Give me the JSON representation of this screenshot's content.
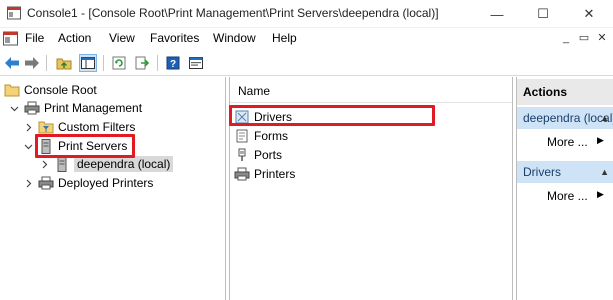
{
  "window": {
    "title": "Console1 - [Console Root\\Print Management\\Print Servers\\deependra (local)]",
    "minimize_glyph": "—",
    "maximize_glyph": "☐",
    "close_glyph": "✕"
  },
  "menu": {
    "items": [
      "File",
      "Action",
      "View",
      "Favorites",
      "Window",
      "Help"
    ],
    "mdi_minimize": "_",
    "mdi_restore": "▭",
    "mdi_close": "✕"
  },
  "toolbar": {
    "buttons": [
      "back-icon",
      "forward-icon",
      "up-folder-icon",
      "show-hide-tree-icon",
      "refresh-icon",
      "export-list-icon",
      "help-icon",
      "properties-icon"
    ]
  },
  "tree": {
    "root": "Console Root",
    "print_management": "Print Management",
    "custom_filters": "Custom Filters",
    "print_servers": "Print Servers",
    "server": "deependra (local)",
    "deployed_printers": "Deployed Printers"
  },
  "list": {
    "column_name": "Name",
    "items": [
      "Drivers",
      "Forms",
      "Ports",
      "Printers"
    ]
  },
  "actions": {
    "header": "Actions",
    "section1": "deependra (local)",
    "more1": "More ...",
    "section2": "Drivers",
    "more2": "More ..."
  },
  "colors": {
    "highlight": "#e01b24",
    "action_section_bg": "#cfe3f6",
    "selection_bg": "#d9d9d9"
  }
}
